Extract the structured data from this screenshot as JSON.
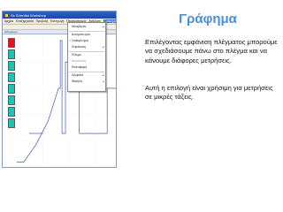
{
  "window": {
    "title": "Ss Scientist Workshop"
  },
  "menubar": {
    "items": [
      "Αρχείο",
      "Επεξεργασία",
      "Προβολή",
      "Εισαγωγή",
      "Πειραματισμός",
      "Ανάλυση",
      "Γράφημα",
      "Σχεδιασμός",
      "Χρήσιμα"
    ],
    "active_index": 6
  },
  "subwindow": {
    "label": "Διάγραμμα"
  },
  "dropdown": {
    "items": [
      {
        "label": "Μεταβλητές",
        "checked": false,
        "submenu": true,
        "disabled": false
      },
      {
        "label": "Αυτόματα όρια",
        "checked": false,
        "submenu": false,
        "disabled": false
      },
      {
        "label": "Σταθερά όρια",
        "checked": true,
        "submenu": false,
        "disabled": false
      },
      {
        "label": "Κλιμάκωση",
        "checked": false,
        "submenu": true,
        "disabled": false
      },
      {
        "label": "Πλέγμα",
        "checked": false,
        "submenu": false,
        "disabled": false
      },
      {
        "label": "Μεγέθυνση",
        "checked": false,
        "submenu": false,
        "disabled": true
      },
      {
        "label": "Επαναφορά",
        "checked": false,
        "submenu": false,
        "disabled": false
      },
      {
        "label": "Χρώματα",
        "checked": false,
        "submenu": true,
        "disabled": false
      },
      {
        "label": "Ιδιότητες",
        "checked": false,
        "submenu": true,
        "disabled": false
      }
    ]
  },
  "channels": [
    {
      "index": "1",
      "color": "#e0161c"
    },
    {
      "index": "2",
      "color": "#17c6b4"
    },
    {
      "index": "3",
      "color": "#17c6b4"
    },
    {
      "index": "4",
      "color": "#17c6b4"
    },
    {
      "index": "5",
      "color": "#17c6b4"
    },
    {
      "index": "6",
      "color": "#17c6b4"
    },
    {
      "index": "7",
      "color": "#17c6b4"
    },
    {
      "index": "8",
      "color": "#17c6b4"
    }
  ],
  "slide": {
    "heading": "Γράφημα",
    "paragraph1": "Επιλέγοντας εμφάνιση πλέγματος μπορούμε να σχεδιάσουμε πάνω στο πλέγμα και να κάνουμε διάφορες μετρήσεις.",
    "paragraph2": "Αυτή η επιλογή είναι χρήσιμη για μετρήσεις σε μικρές τάξεις."
  },
  "colors": {
    "heading": "#4a8fd6",
    "titlebar": "#2d63c8",
    "menu_highlight": "#316ac5"
  }
}
